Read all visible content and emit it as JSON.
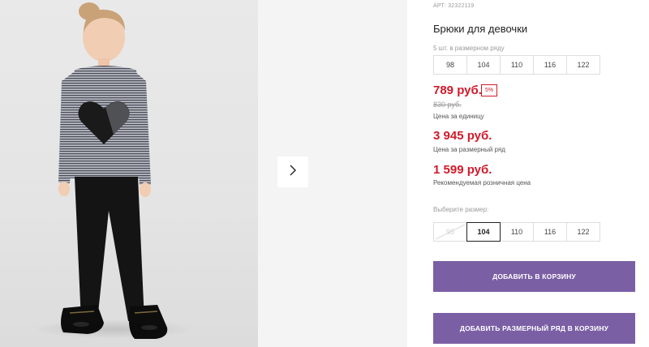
{
  "product": {
    "article": "АРТ: 32322119",
    "title": "Брюки для девочки"
  },
  "series": {
    "label": "5 шт. в размерном ряду",
    "sizes": [
      "98",
      "104",
      "110",
      "116",
      "122"
    ]
  },
  "pricing": {
    "unit_price": "789 руб.",
    "discount_badge": "5%",
    "old_price": "830 руб.",
    "unit_caption": "Цена за единицу",
    "series_price": "3 945 руб.",
    "series_caption": "Цена за размерный ряд",
    "retail_price": "1 599 руб.",
    "retail_caption": "Рекомендуемая розничная цена"
  },
  "size_picker": {
    "label": "Выберите размер:",
    "options": [
      {
        "label": "98",
        "state": "disabled"
      },
      {
        "label": "104",
        "state": "selected"
      },
      {
        "label": "110",
        "state": "available"
      },
      {
        "label": "116",
        "state": "available"
      },
      {
        "label": "122",
        "state": "available"
      }
    ]
  },
  "actions": {
    "add_to_cart": "ДОБАВИТЬ В КОРЗИНУ",
    "add_series_to_cart": "ДОБАВИТЬ РАЗМЕРНЫЙ РЯД В КОРЗИНУ"
  },
  "gallery": {
    "next_icon": "chevron-right-icon"
  },
  "colors": {
    "price_red": "#d11a2a",
    "button_purple": "#7b5fa5"
  }
}
